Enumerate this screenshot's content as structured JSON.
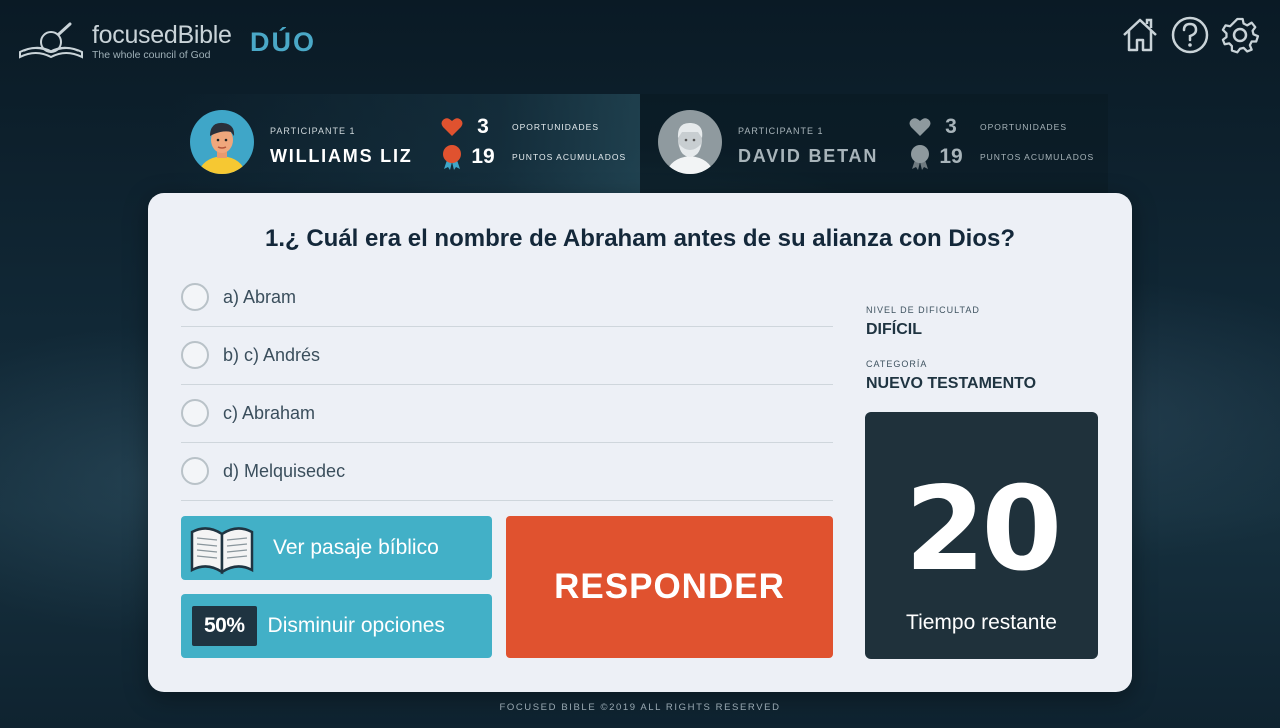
{
  "header": {
    "brand_name": "focusedBible",
    "brand_tagline": "The whole council of God",
    "mode": "DÚO",
    "icons": [
      "home-icon",
      "help-icon",
      "gear-icon"
    ]
  },
  "players": [
    {
      "role": "PARTICIPANTE 1",
      "name": "WILLIAMS LIZ",
      "lives": "3",
      "lives_label": "OPORTUNIDADES",
      "points": "19",
      "points_label": "PUNTOS ACUMULADOS",
      "active": true
    },
    {
      "role": "PARTICIPANTE 1",
      "name": "DAVID BETAN",
      "lives": "3",
      "lives_label": "OPORTUNIDADES",
      "points": "19",
      "points_label": "PUNTOS ACUMULADOS",
      "active": false
    }
  ],
  "question": {
    "text": "1.¿ Cuál era el nombre de Abraham antes de su alianza con Dios?",
    "options": [
      "a) Abram",
      "b) c) Andrés",
      "c) Abraham",
      "d) Melquisedec"
    ]
  },
  "actions": {
    "passage_label": "Ver pasaje bíblico",
    "half_badge": "50%",
    "half_label": "Disminuir opciones",
    "answer_label": "RESPONDER"
  },
  "meta": {
    "difficulty_label": "NIVEL DE DIFICULTAD",
    "difficulty_value": "DIFÍCIL",
    "category_label": "CATEGORÍA",
    "category_value": "NUEVO TESTAMENTO"
  },
  "timer": {
    "value": "20",
    "label": "Tiempo restante"
  },
  "footer": "FOCUSED BIBLE ©2019 ALL RIGHTS RESERVED",
  "colors": {
    "accent": "#e0522f",
    "teal": "#42b0c7",
    "dark": "#1f313b",
    "brand": "#4aa8c7"
  }
}
